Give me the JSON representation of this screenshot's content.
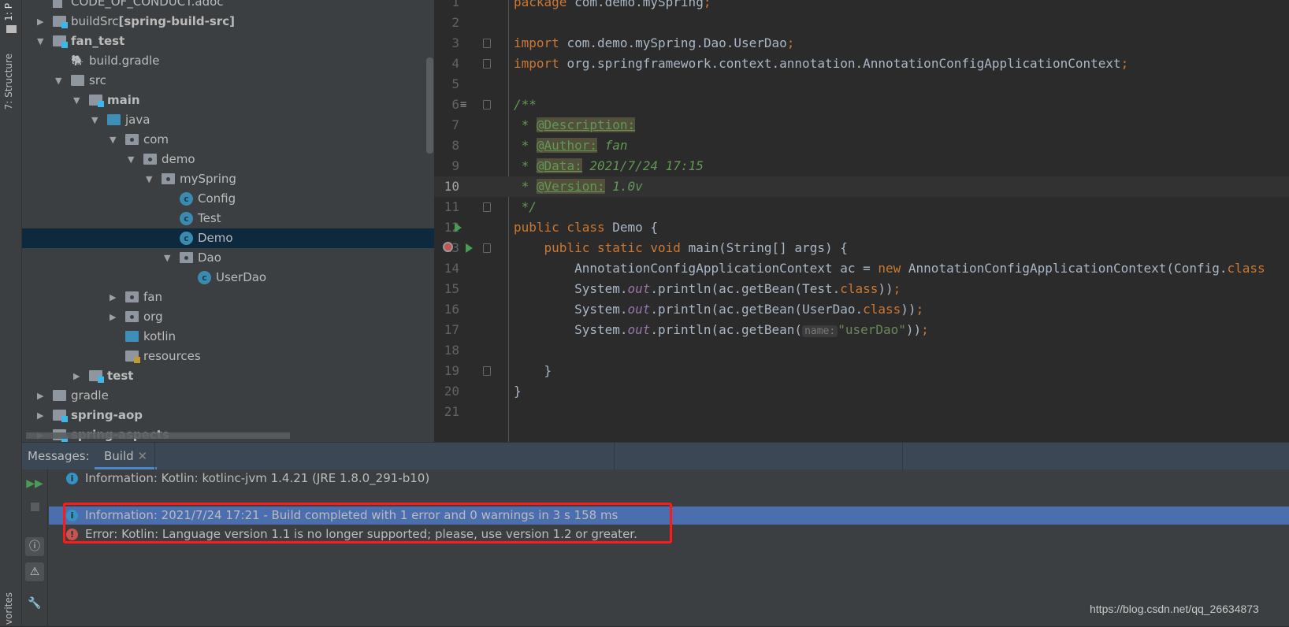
{
  "sidebar_strip": {
    "project_tab": "1: P",
    "structure_tab": "7: Structure",
    "favorites_tab": "vorites"
  },
  "tree": [
    {
      "label": "CODE_OF_CONDUCT.adoc",
      "level": 0,
      "arrow": "none",
      "icon": "file",
      "bold": false
    },
    {
      "label": "buildSrc",
      "suffix": "[spring-build-src]",
      "level": 0,
      "arrow": "closed",
      "icon": "module",
      "bold": false
    },
    {
      "label": "fan_test",
      "level": 0,
      "arrow": "open",
      "icon": "module",
      "bold": true
    },
    {
      "label": "build.gradle",
      "level": 1,
      "arrow": "none",
      "icon": "gradle",
      "bold": false
    },
    {
      "label": "src",
      "level": 1,
      "arrow": "open",
      "icon": "folder",
      "bold": false
    },
    {
      "label": "main",
      "level": 2,
      "arrow": "open",
      "icon": "module",
      "bold": true
    },
    {
      "label": "java",
      "level": 3,
      "arrow": "open",
      "icon": "source",
      "bold": false
    },
    {
      "label": "com",
      "level": 4,
      "arrow": "open",
      "icon": "package",
      "bold": false
    },
    {
      "label": "demo",
      "level": 5,
      "arrow": "open",
      "icon": "package",
      "bold": false
    },
    {
      "label": "mySpring",
      "level": 6,
      "arrow": "open",
      "icon": "package",
      "bold": false
    },
    {
      "label": "Config",
      "level": 7,
      "arrow": "none",
      "icon": "class",
      "bold": false
    },
    {
      "label": "Test",
      "level": 7,
      "arrow": "none",
      "icon": "class",
      "bold": false
    },
    {
      "label": "Demo",
      "level": 7,
      "arrow": "none",
      "icon": "class-run",
      "bold": false,
      "selected": true
    },
    {
      "label": "Dao",
      "level": 7,
      "arrow": "open",
      "icon": "package",
      "bold": false
    },
    {
      "label": "UserDao",
      "level": 8,
      "arrow": "none",
      "icon": "class",
      "bold": false
    },
    {
      "label": "fan",
      "level": 4,
      "arrow": "closed",
      "icon": "package",
      "bold": false
    },
    {
      "label": "org",
      "level": 4,
      "arrow": "closed",
      "icon": "package",
      "bold": false
    },
    {
      "label": "kotlin",
      "level": 4,
      "arrow": "none",
      "icon": "source",
      "bold": false
    },
    {
      "label": "resources",
      "level": 4,
      "arrow": "none",
      "icon": "resources",
      "bold": false
    },
    {
      "label": "test",
      "level": 2,
      "arrow": "closed",
      "icon": "module",
      "bold": true
    },
    {
      "label": "gradle",
      "level": 0,
      "arrow": "closed",
      "icon": "folder",
      "bold": false
    },
    {
      "label": "spring-aop",
      "level": 0,
      "arrow": "closed",
      "icon": "module",
      "bold": true
    },
    {
      "label": "spring-aspects",
      "level": 0,
      "arrow": "closed",
      "icon": "module",
      "bold": true
    }
  ],
  "editor": {
    "current_line": 10,
    "lines": [
      [
        [
          "kw",
          "package "
        ],
        [
          "",
          "com.demo.mySpring"
        ],
        [
          "kw",
          ";"
        ]
      ],
      [],
      [
        [
          "kw",
          "import "
        ],
        [
          "",
          "com.demo.mySpring.Dao.UserDao"
        ],
        [
          "kw",
          ";"
        ]
      ],
      [
        [
          "kw",
          "import "
        ],
        [
          "",
          "org.springframework.context.annotation.AnnotationConfigApplicationContext"
        ],
        [
          "kw",
          ";"
        ]
      ],
      [],
      [
        [
          "cm",
          "/**"
        ]
      ],
      [
        [
          "cm",
          " * "
        ],
        [
          "tag",
          "@Description:"
        ]
      ],
      [
        [
          "cm",
          " * "
        ],
        [
          "tag",
          "@Author:"
        ],
        [
          "cm",
          " fan"
        ]
      ],
      [
        [
          "cm",
          " * "
        ],
        [
          "tag",
          "@Data:"
        ],
        [
          "cm",
          " 2021/7/24 17:15"
        ]
      ],
      [
        [
          "cm",
          " * "
        ],
        [
          "tag",
          "@Version:"
        ],
        [
          "cm",
          " 1.0v"
        ]
      ],
      [
        [
          "cm",
          " */"
        ]
      ],
      [
        [
          "kw",
          "public class "
        ],
        [
          "",
          "Demo {"
        ]
      ],
      [
        [
          "",
          "    "
        ],
        [
          "kw",
          "public static void "
        ],
        [
          "",
          "main(String[] args) {"
        ]
      ],
      [
        [
          "",
          "        AnnotationConfigApplicationContext ac = "
        ],
        [
          "kw",
          "new "
        ],
        [
          "",
          "AnnotationConfigApplicationContext(Config."
        ],
        [
          "kw",
          "class"
        ]
      ],
      [
        [
          "",
          "        System."
        ],
        [
          "st",
          "out"
        ],
        [
          "",
          ".println(ac.getBean(Test."
        ],
        [
          "kw",
          "class"
        ],
        [
          "",
          "))"
        ],
        [
          "kw",
          ";"
        ]
      ],
      [
        [
          "",
          "        System."
        ],
        [
          "st",
          "out"
        ],
        [
          "",
          ".println(ac.getBean(UserDao."
        ],
        [
          "kw",
          "class"
        ],
        [
          "",
          "))"
        ],
        [
          "kw",
          ";"
        ]
      ],
      [
        [
          "",
          "        System."
        ],
        [
          "st",
          "out"
        ],
        [
          "",
          ".println(ac.getBean("
        ],
        [
          "hint",
          "name:"
        ],
        [
          "str",
          "\"userDao\""
        ],
        [
          "",
          "))"
        ],
        [
          "kw",
          ";"
        ]
      ],
      [],
      [
        [
          "",
          "    }"
        ]
      ],
      [
        [
          "",
          "}"
        ]
      ],
      []
    ],
    "run_lines": [
      12,
      13
    ],
    "fold_lines": [
      3,
      4,
      6,
      11,
      13,
      19
    ]
  },
  "bottom_panel": {
    "label": "Messages:",
    "tab": "Build",
    "messages": [
      {
        "type": "info",
        "text": "Information: Kotlin: kotlinc-jvm 1.4.21 (JRE 1.8.0_291-b10)"
      },
      {
        "type": "info",
        "text": "Information: 2021/7/24 17:21 - Build completed with 1 error and 0 warnings in 3 s 158 ms",
        "selected": true
      },
      {
        "type": "error",
        "text": "Error: Kotlin: Language version 1.1 is no longer supported; please, use version 1.2 or greater."
      }
    ]
  },
  "watermark": "https://blog.csdn.net/qq_26634873",
  "colors": {
    "selection": "#4b6eaf",
    "error": "#c75450",
    "info": "#3592c4",
    "highlight_box": "#ff1a1a"
  }
}
